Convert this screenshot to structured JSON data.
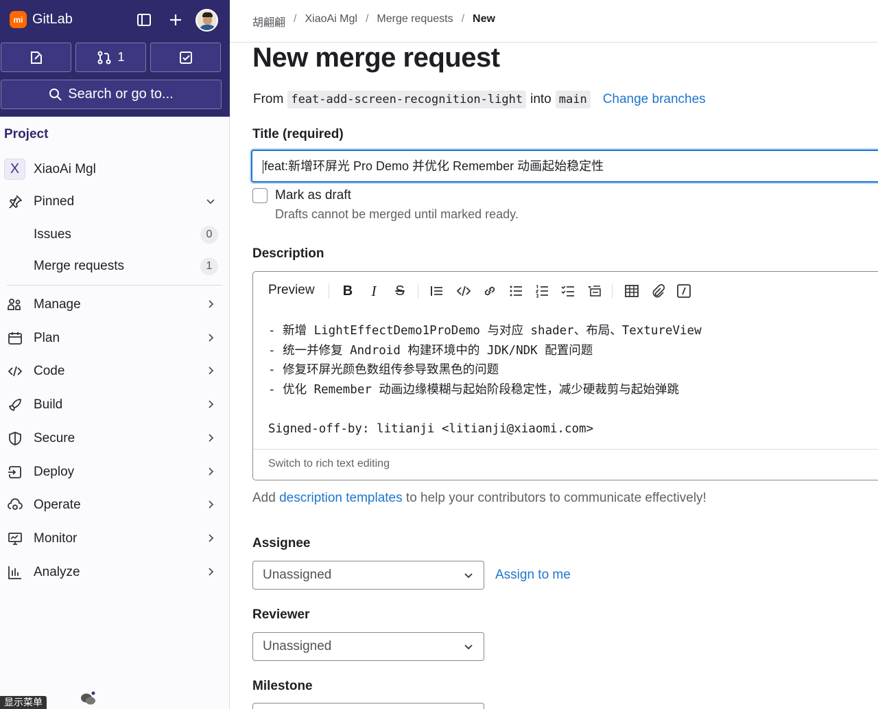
{
  "app": {
    "name": "GitLab"
  },
  "topbar": {
    "merge_requests_count": "1",
    "search_label": "Search or go to..."
  },
  "sidebar": {
    "section_title": "Project",
    "project_initial": "X",
    "project_name": "XiaoAi Mgl",
    "pinned_label": "Pinned",
    "pinned_items": [
      {
        "label": "Issues",
        "count": "0"
      },
      {
        "label": "Merge requests",
        "count": "1"
      }
    ],
    "nav": [
      "Manage",
      "Plan",
      "Code",
      "Build",
      "Secure",
      "Deploy",
      "Operate",
      "Monitor",
      "Analyze"
    ],
    "tooltip": "显示菜单"
  },
  "breadcrumb": [
    "胡翩翩",
    "XiaoAi Mgl",
    "Merge requests",
    "New"
  ],
  "page": {
    "title": "New merge request",
    "from_label": "From",
    "source_branch": "feat-add-screen-recognition-light",
    "into_label": "into",
    "target_branch": "main",
    "change_branches": "Change branches"
  },
  "form": {
    "title_label": "Title (required)",
    "title_value": "feat:新增环屏光 Pro Demo 并优化 Remember 动画起始稳定性",
    "draft_label": "Mark as draft",
    "draft_help": "Drafts cannot be merged until marked ready.",
    "description_label": "Description",
    "preview_tab": "Preview",
    "description_lines": [
      "- 新增 LightEffectDemo1ProDemo 与对应 shader、布局、TextureView",
      "- 统一并修复 Android 构建环境中的 JDK/NDK 配置问题",
      "- 修复环屏光颜色数组传参导致黑色的问题",
      "- 优化 Remember 动画边缘模糊与起始阶段稳定性，减少硬裁剪与起始弹跳",
      "",
      "Signed-off-by: litianji <litianji@xiaomi.com>"
    ],
    "switch_rich_text": "Switch to rich text editing",
    "templates_prefix": "Add ",
    "templates_link": "description templates",
    "templates_suffix": " to help your contributors to communicate effectively!",
    "assignee_label": "Assignee",
    "assignee_value": "Unassigned",
    "assign_to_me": "Assign to me",
    "reviewer_label": "Reviewer",
    "reviewer_value": "Unassigned",
    "milestone_label": "Milestone"
  },
  "colors": {
    "topbar_bg": "#2f2a6b",
    "link": "#1f75cb",
    "brand_logo": "#ff6900"
  }
}
